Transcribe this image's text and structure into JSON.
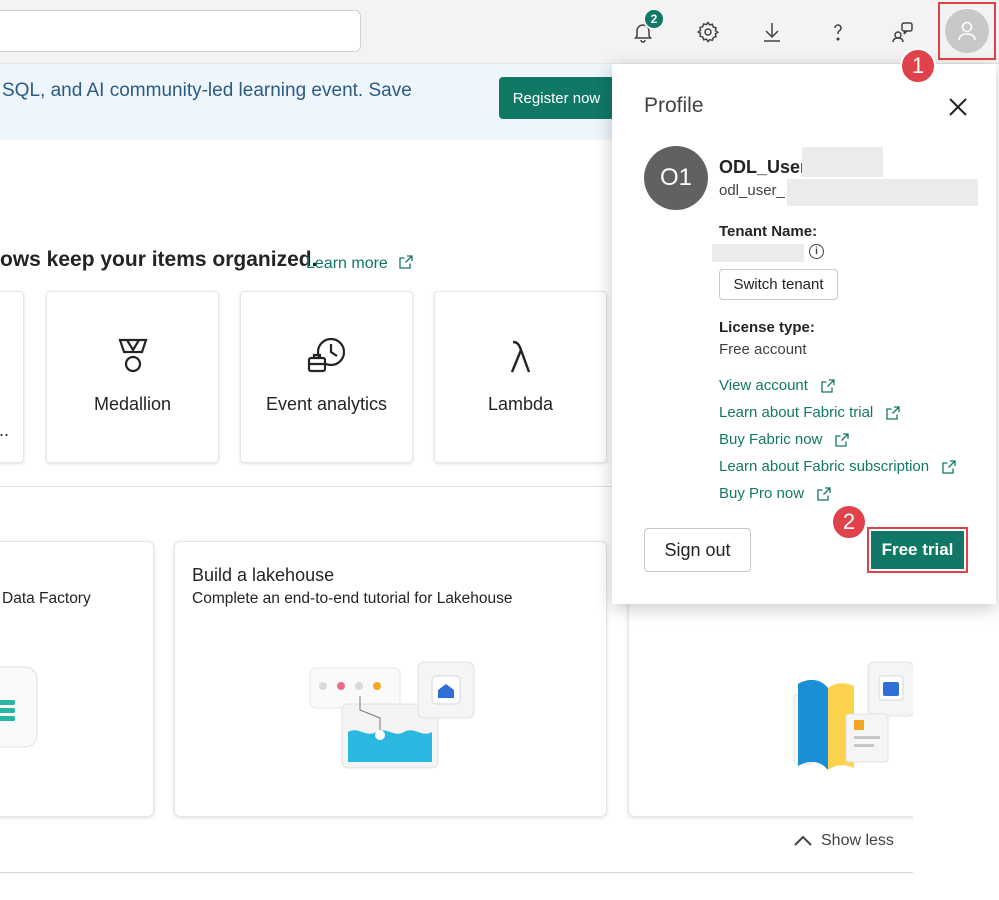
{
  "topbar": {
    "notification_count": "2",
    "icons": [
      "bell-icon",
      "gear-icon",
      "download-icon",
      "help-icon",
      "feedback-icon",
      "user-icon"
    ]
  },
  "banner": {
    "text": "SQL, and AI community-led learning event. Save",
    "register_label": "Register now"
  },
  "main": {
    "section_heading": "ows keep your items organized.",
    "learn_more": "Learn more",
    "task_cards": [
      {
        "label": "Medallion",
        "icon": "medal-icon"
      },
      {
        "label": "Event analytics",
        "icon": "event-analytics-icon"
      },
      {
        "label": "Lambda",
        "icon": "lambda-icon"
      }
    ],
    "partial_card_text": "..",
    "tutorials": [
      {
        "title": "",
        "desc": "Data Factory"
      },
      {
        "title": "Build a lakehouse",
        "desc": "Complete an end-to-end tutorial for Lakehouse"
      }
    ],
    "show_less": "Show less"
  },
  "profile": {
    "title": "Profile",
    "avatar_initials": "O1",
    "name": "ODL_User",
    "email": "odl_user_",
    "tenant_label": "Tenant Name:",
    "switch_tenant": "Switch tenant",
    "license_label": "License type:",
    "license_value": "Free account",
    "links": [
      "View account",
      "Learn about Fabric trial",
      "Buy Fabric now",
      "Learn about Fabric subscription",
      "Buy Pro now"
    ],
    "sign_out": "Sign out",
    "free_trial": "Free trial"
  },
  "callouts": [
    "1",
    "2"
  ],
  "colors": {
    "accent": "#117865",
    "highlight": "#e0424b",
    "banner_bg": "#eef5fd"
  }
}
